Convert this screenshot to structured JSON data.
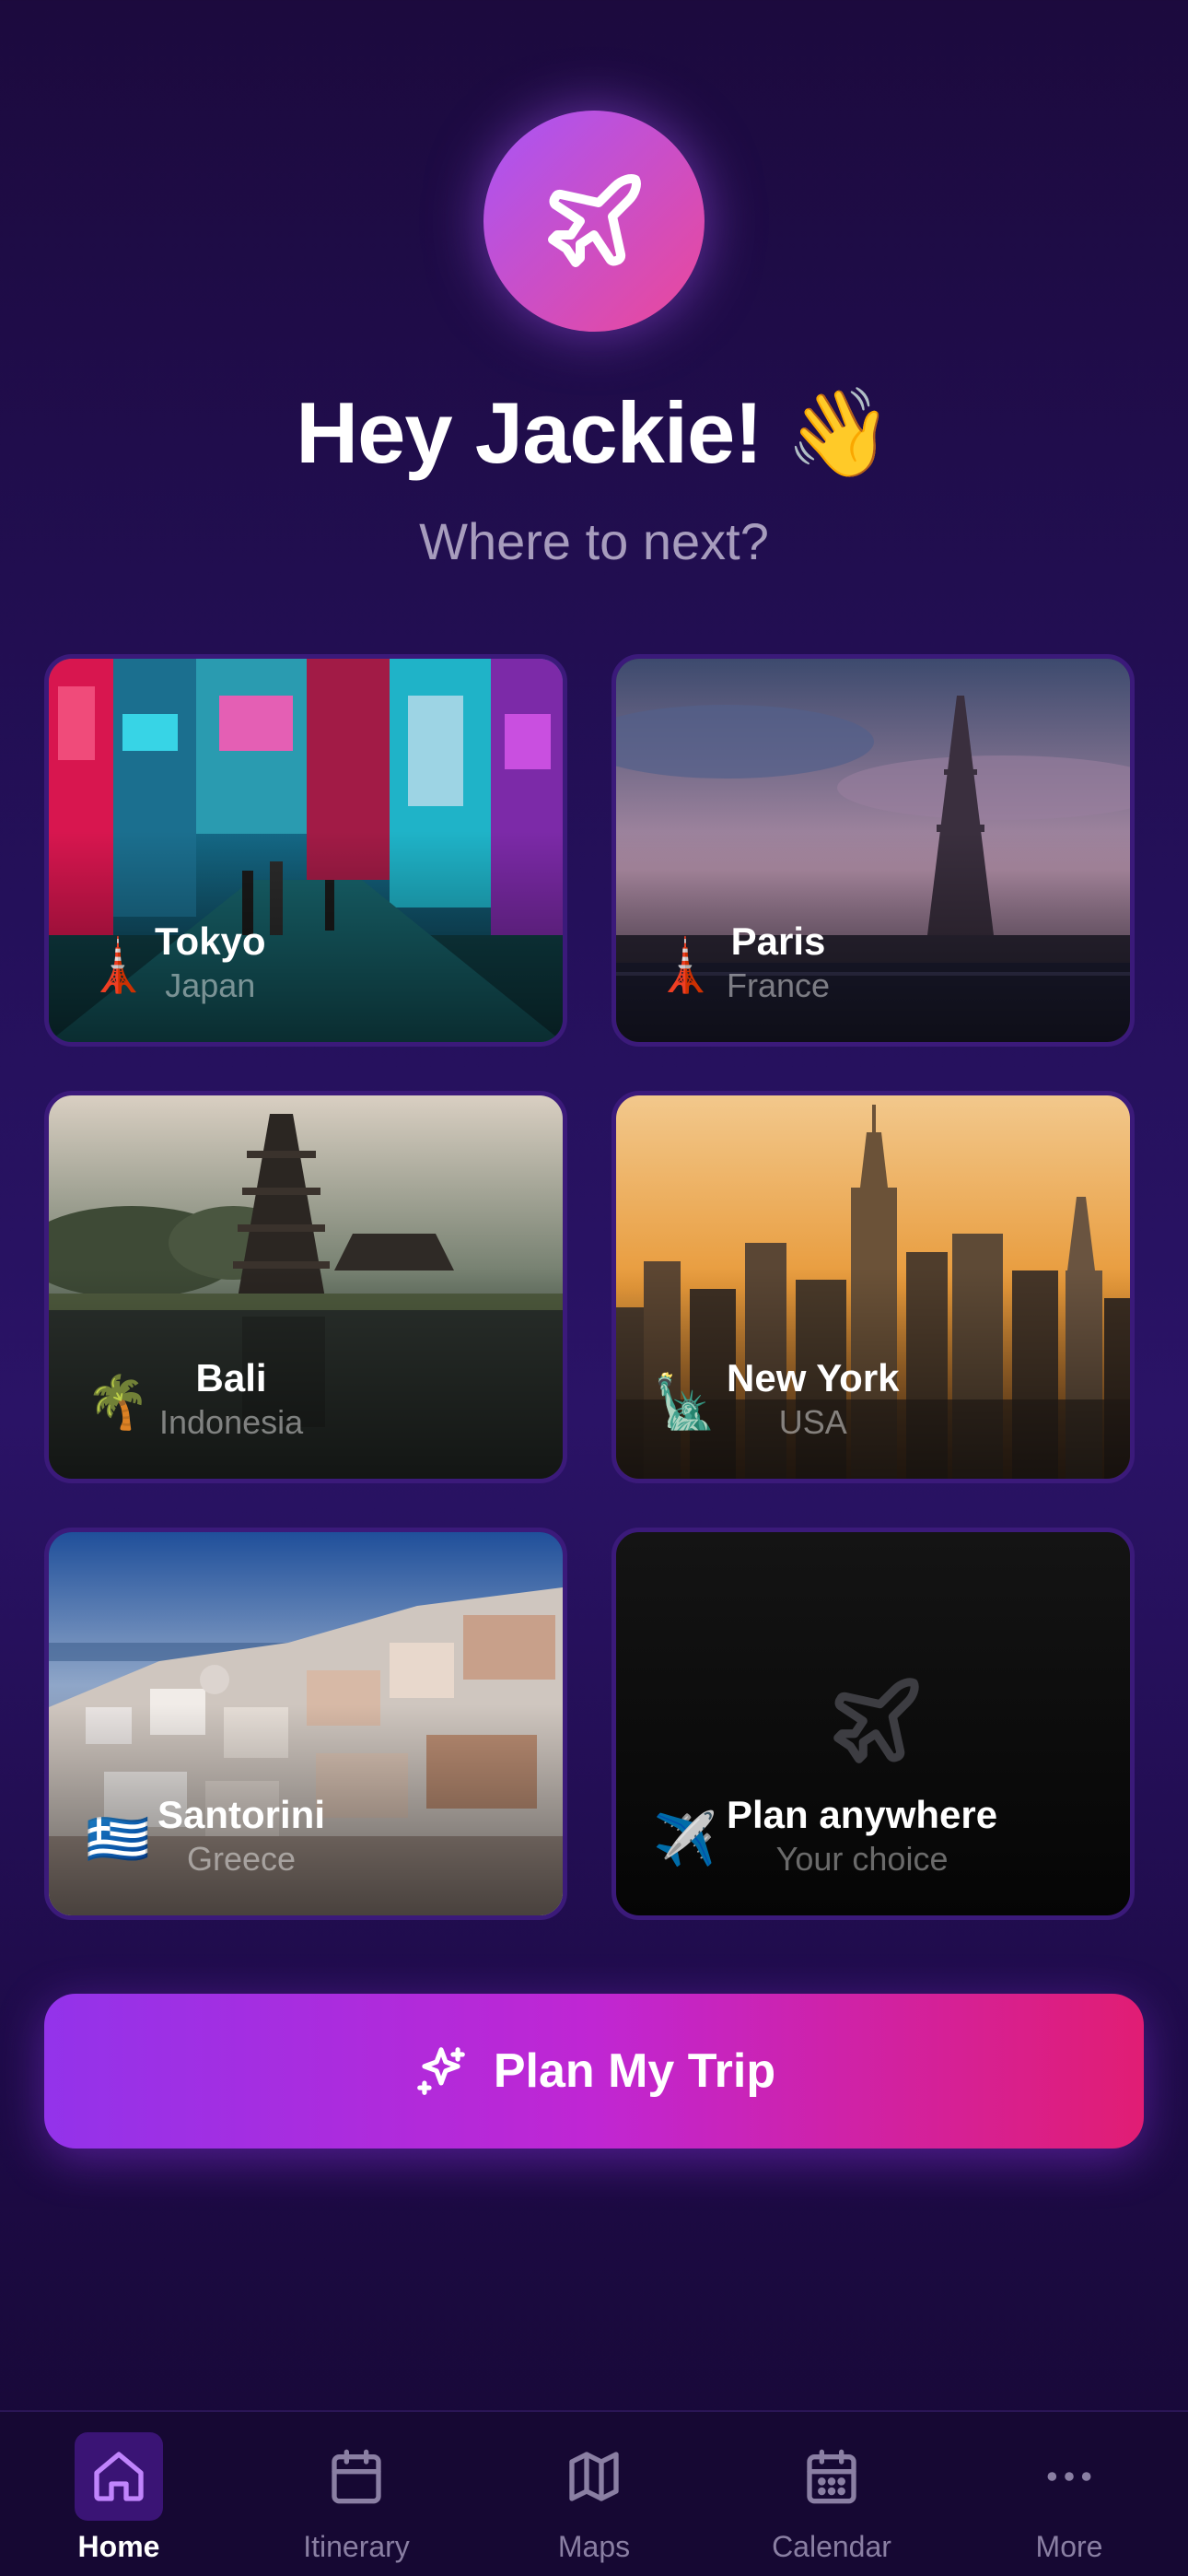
{
  "header": {
    "greeting": "Hey Jackie! 👋",
    "subtitle": "Where to next?",
    "icon": "airplane-icon"
  },
  "destinations": [
    {
      "name": "Tokyo",
      "country": "Japan",
      "emoji": "🗼"
    },
    {
      "name": "Paris",
      "country": "France",
      "emoji": "🗼"
    },
    {
      "name": "Bali",
      "country": "Indonesia",
      "emoji": "🌴"
    },
    {
      "name": "New York",
      "country": "USA",
      "emoji": "🗽"
    },
    {
      "name": "Santorini",
      "country": "Greece",
      "emoji": "🇬🇷"
    },
    {
      "name": "Plan anywhere",
      "country": "Your choice",
      "emoji": "✈️"
    }
  ],
  "cta": {
    "label": "Plan My Trip",
    "icon": "sparkles-icon"
  },
  "tabbar": {
    "tabs": [
      {
        "label": "Home",
        "icon": "home-icon",
        "active": true
      },
      {
        "label": "Itinerary",
        "icon": "calendar-icon"
      },
      {
        "label": "Maps",
        "icon": "map-icon"
      },
      {
        "label": "Calendar",
        "icon": "calendar-grid-icon"
      },
      {
        "label": "More",
        "icon": "more-icon"
      }
    ]
  },
  "colors": {
    "accent_start": "#a855f7",
    "accent_end": "#ec4899",
    "background": "#24105a",
    "card_border": "#3b1a7a"
  }
}
